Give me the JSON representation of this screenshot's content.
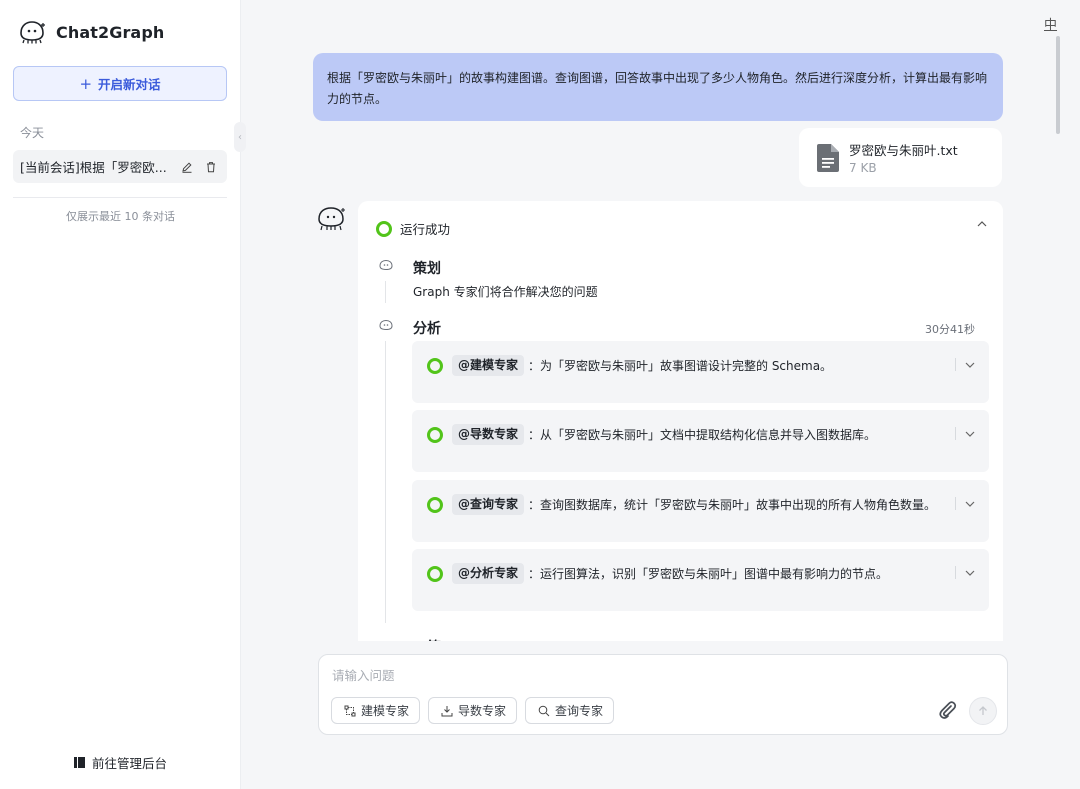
{
  "app": {
    "title": "Chat2Graph"
  },
  "sidebar": {
    "new_chat_label": "开启新对话",
    "group_label": "今天",
    "conversations": [
      {
        "title": "[当前会话]根据「罗密欧..."
      }
    ],
    "limit_note": "仅展示最近 10 条对话",
    "admin_link": "前往管理后台"
  },
  "header": {
    "lang_toggle": "中"
  },
  "chat": {
    "user_message": "根据「罗密欧与朱丽叶」的故事构建图谱。查询图谱，回答故事中出现了多少人物角色。然后进行深度分析，计算出最有影响力的节点。",
    "attachment": {
      "name": "罗密欧与朱丽叶.txt",
      "size": "7 KB"
    },
    "answer": {
      "status": "运行成功",
      "steps": [
        {
          "title": "策划",
          "description": "Graph 专家们将合作解决您的问题"
        },
        {
          "title": "分析",
          "duration": "30分41秒"
        }
      ],
      "tasks": [
        {
          "expert": "@建模专家",
          "text": "：为「罗密欧与朱丽叶」故事图谱设计完整的 Schema。"
        },
        {
          "expert": "@导数专家",
          "text": "：从「罗密欧与朱丽叶」文档中提取结构化信息并导入图数据库。"
        },
        {
          "expert": "@查询专家",
          "text": "：查询图数据库，统计「罗密欧与朱丽叶」故事中出现的所有人物角色数量。"
        },
        {
          "expert": "@分析专家",
          "text": "：运行图算法，识别「罗密欧与朱丽叶」图谱中最有影响力的节点。"
        }
      ],
      "next_step_partial": "二答"
    }
  },
  "composer": {
    "placeholder": "请输入问题",
    "chips": [
      "建模专家",
      "导数专家",
      "查询专家"
    ]
  },
  "colors": {
    "accent": "#3b5bdb",
    "success": "#52c41a",
    "user_bubble": "#bcc9f6"
  }
}
